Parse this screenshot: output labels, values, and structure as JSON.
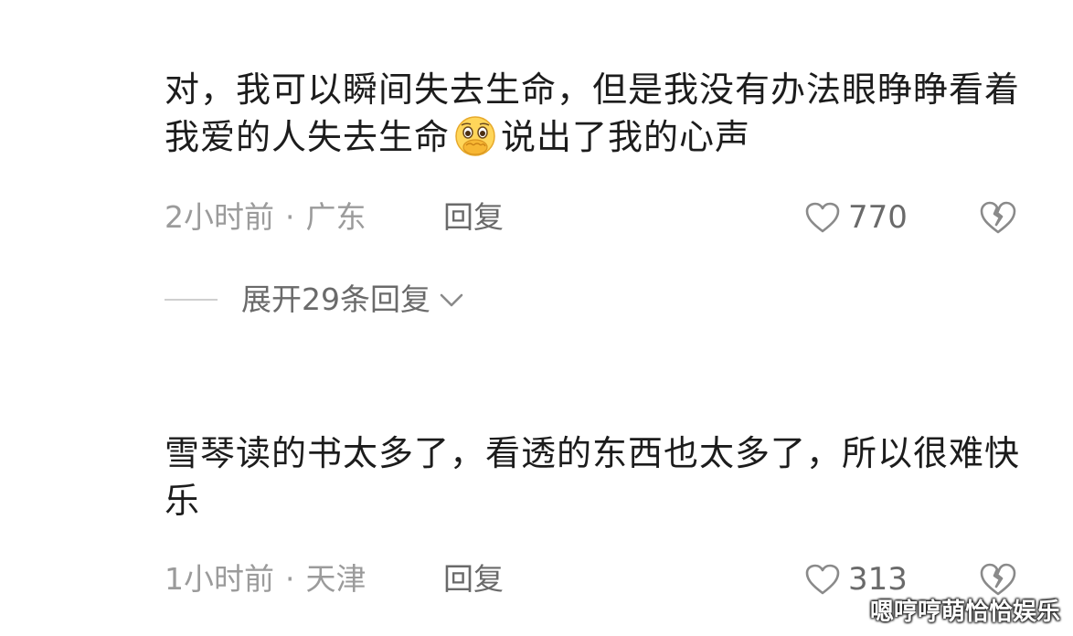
{
  "comments": [
    {
      "text_before_emoji": "对，我可以瞬间失去生命，但是我没有办法眼睁睁看着我爱的人失去生命",
      "emoji": "holding-back-tears-emoji",
      "text_after_emoji": "说出了我的心声",
      "time": "2小时前",
      "location": "广东",
      "reply_label": "回复",
      "like_count": "770",
      "expand_label": "展开29条回复"
    },
    {
      "text": "雪琴读的书太多了，看透的东西也太多了，所以很难快乐",
      "time": "1小时前",
      "location": "天津",
      "reply_label": "回复",
      "like_count": "313"
    }
  ],
  "separator": "·",
  "watermark": "嗯哼哼萌恰恰娱乐",
  "colors": {
    "text": "#1c1c1c",
    "meta": "#9b9b9b",
    "action": "#6a6a6a",
    "icon": "#8a8a8a"
  }
}
